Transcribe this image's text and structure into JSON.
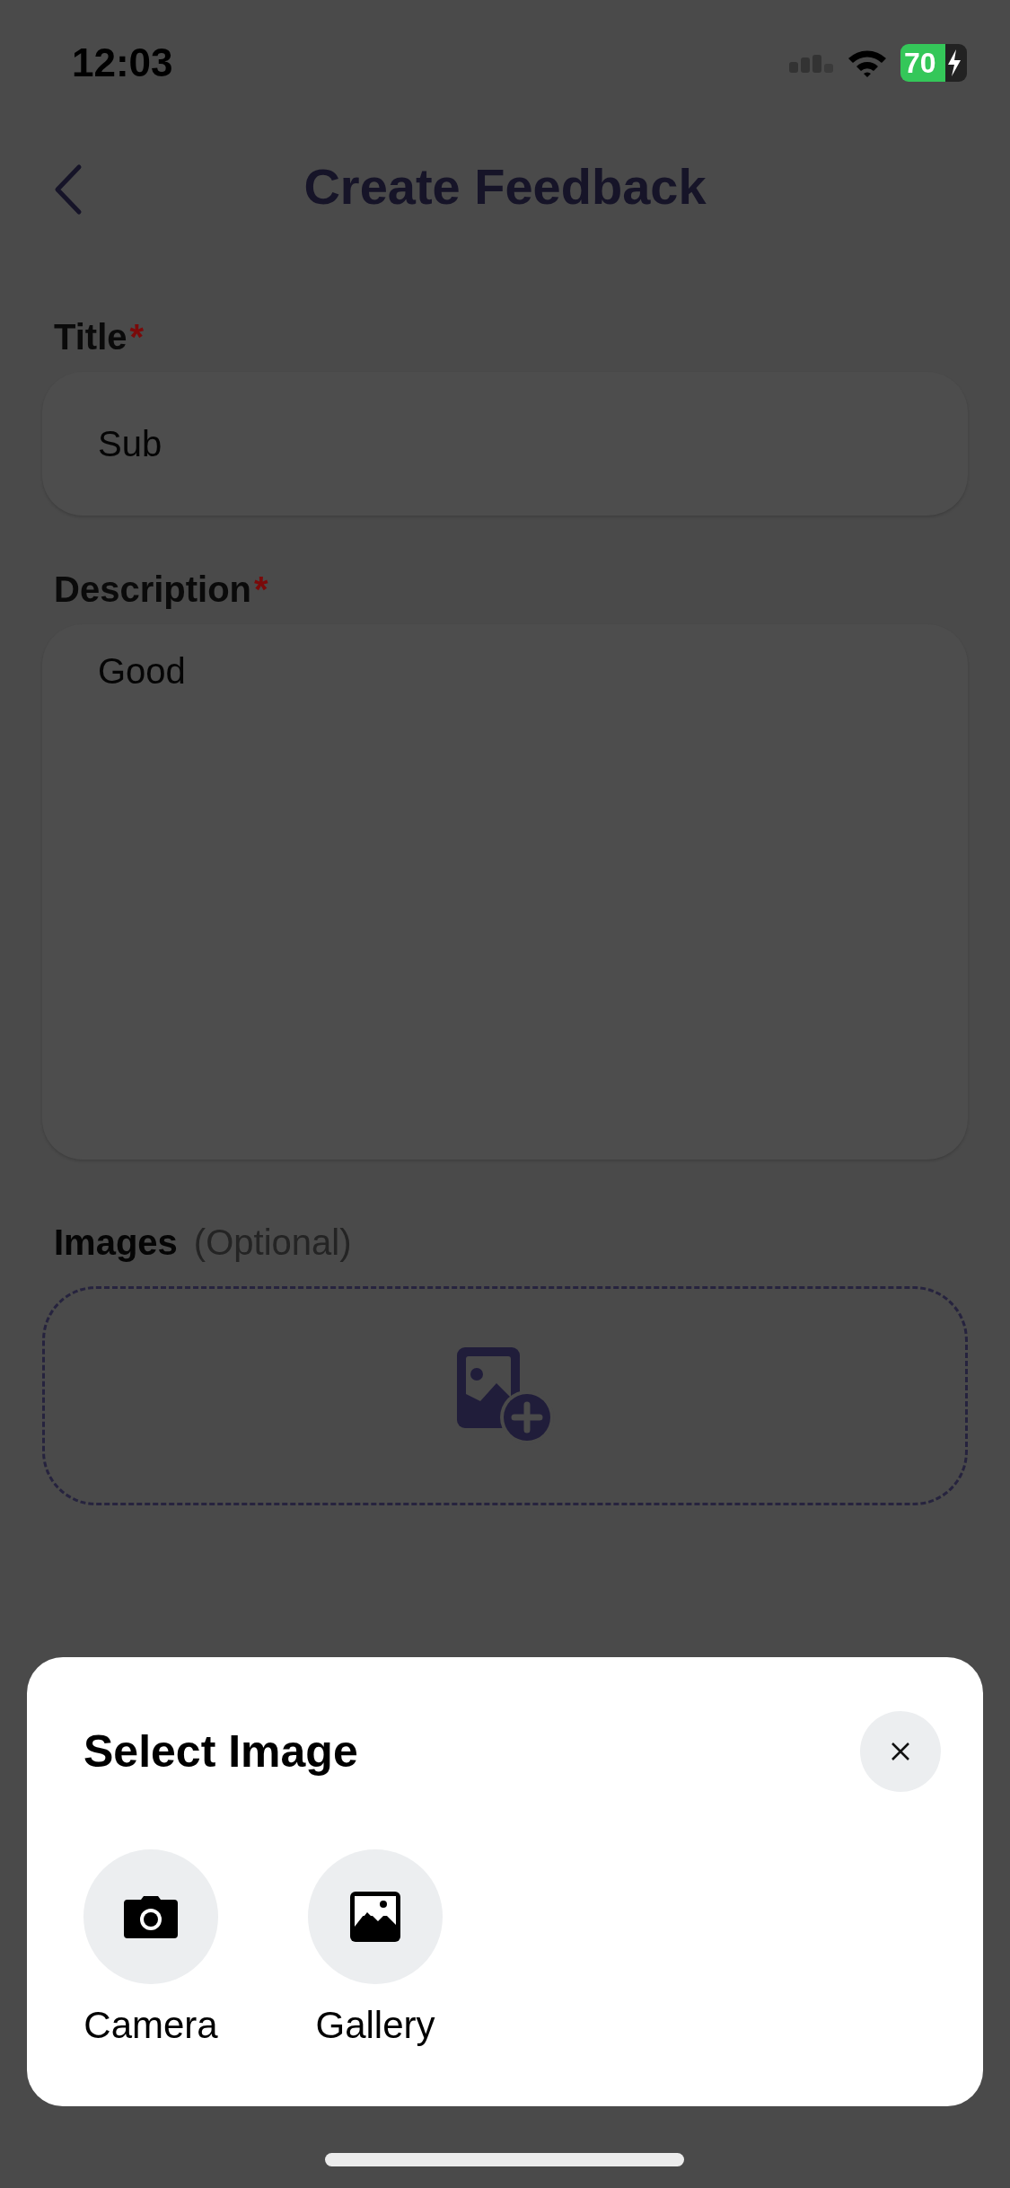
{
  "status_bar": {
    "time": "12:03",
    "battery": "70"
  },
  "header": {
    "title": "Create Feedback"
  },
  "fields": [
    {
      "kind": "line",
      "label": "Title",
      "required_mark": "*",
      "value": "Sub"
    },
    {
      "kind": "area",
      "label": "Description",
      "required_mark": "*",
      "value": "Good"
    }
  ],
  "images": {
    "label": "Images",
    "hint": "(Optional)"
  },
  "sheet": {
    "title": "Select Image",
    "options": [
      {
        "kind": "camera",
        "label": "Camera"
      },
      {
        "kind": "gallery",
        "label": "Gallery"
      }
    ]
  }
}
